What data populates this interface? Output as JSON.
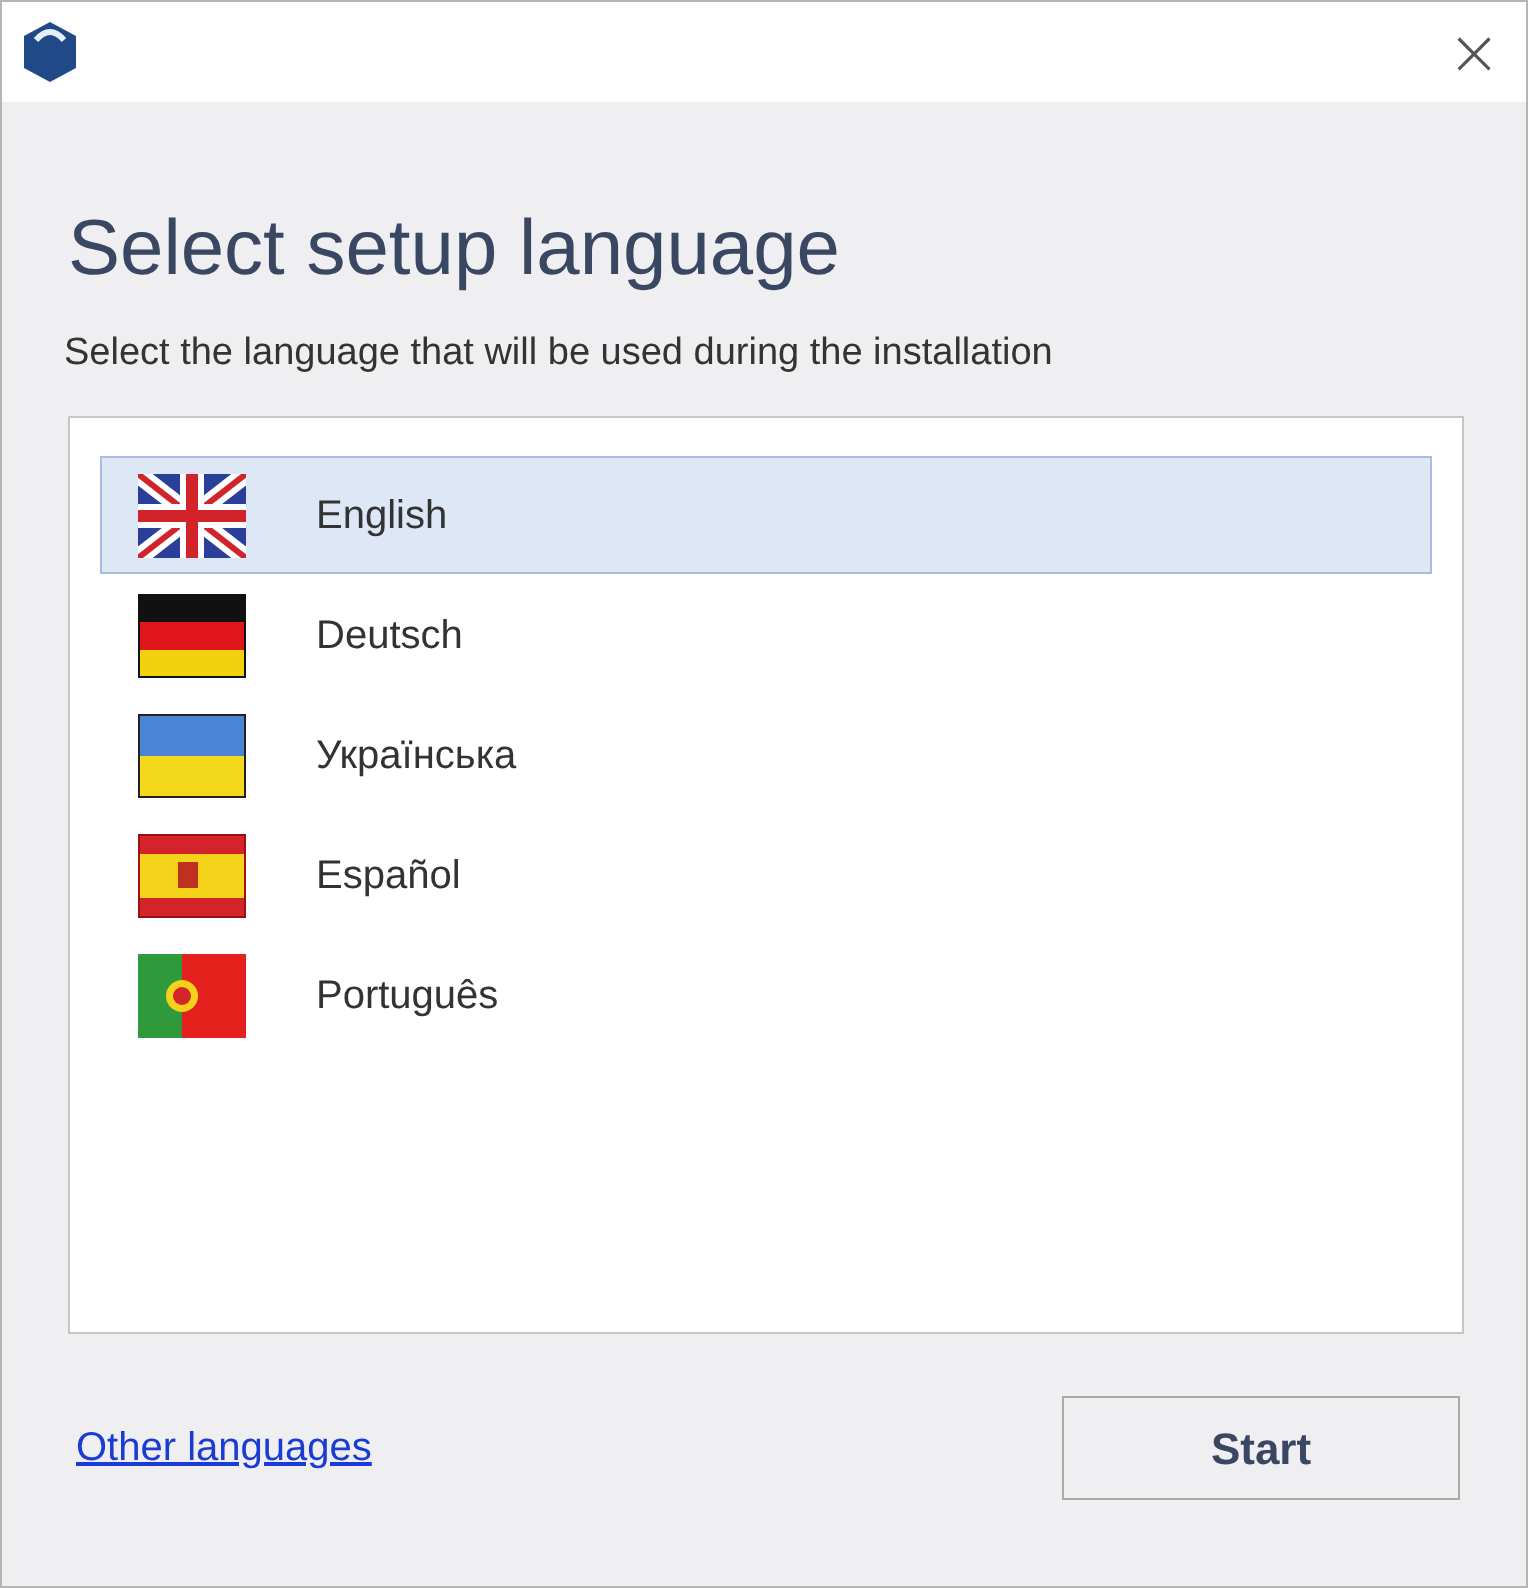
{
  "window": {
    "close": "×"
  },
  "heading": "Select setup language",
  "subtitle": "Select the language that will be used during the installation",
  "languages": [
    {
      "kind": "uk",
      "label": "English",
      "selected": true
    },
    {
      "kind": "de",
      "label": "Deutsch",
      "selected": false
    },
    {
      "kind": "ua",
      "label": "Українська",
      "selected": false
    },
    {
      "kind": "es",
      "label": "Español",
      "selected": false
    },
    {
      "kind": "pt",
      "label": "Português",
      "selected": false
    }
  ],
  "other_link": "Other languages",
  "start_button": "Start"
}
